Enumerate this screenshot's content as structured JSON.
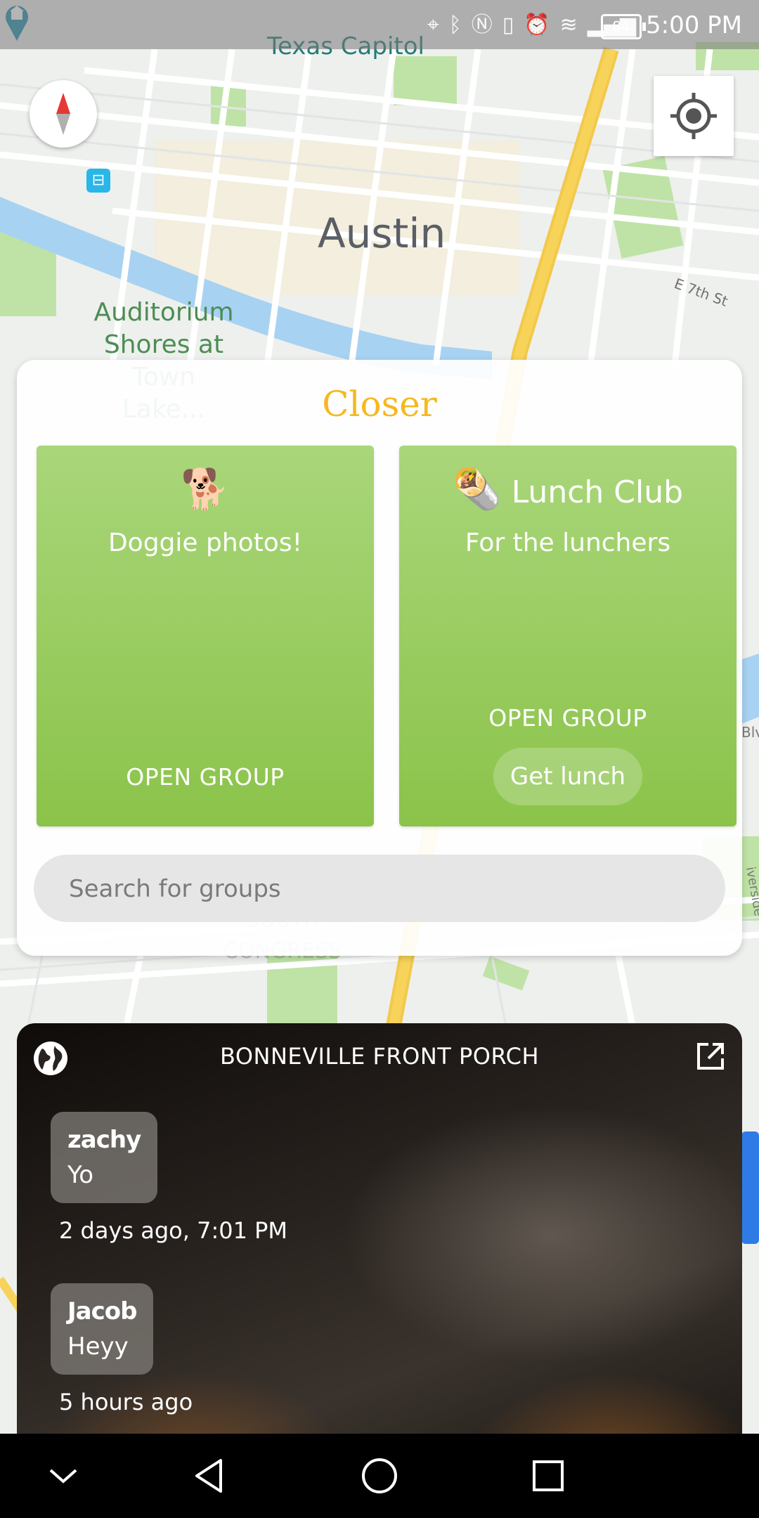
{
  "status_bar": {
    "time": "5:00 PM",
    "battery": "84",
    "icons": [
      "location-icon",
      "bluetooth-icon",
      "nfc-icon",
      "vibrate-icon",
      "alarm-icon",
      "wifi-icon",
      "signal-icon"
    ]
  },
  "map": {
    "labels": {
      "capitol": "Texas Capitol",
      "city": "Austin",
      "auditorium": "Auditorium Shores at Town Lake...",
      "e7th": "E 7th St",
      "south_congress": "SOUTH CONGRESS",
      "blv": "Blv",
      "riverside": "iverside"
    },
    "colors": {
      "water": "#a8d2f2",
      "park": "#bfe3a6",
      "highway": "#f7d35a",
      "road": "#ffffff"
    }
  },
  "closer": {
    "title": "Closer",
    "groups": [
      {
        "emoji": "🐕",
        "name": "",
        "description": "Doggie photos!",
        "open_label": "OPEN GROUP"
      },
      {
        "emoji": "🌯",
        "name": "Lunch Club",
        "description": "For the lunchers",
        "open_label": "OPEN GROUP",
        "action_label": "Get lunch"
      }
    ],
    "search_placeholder": "Search for groups",
    "colors": {
      "title": "#f5b81f",
      "card": "#8bc34a"
    }
  },
  "chat": {
    "title": "BONNEVILLE FRONT PORCH",
    "messages": [
      {
        "user": "zachy",
        "text": "Yo",
        "time": "2 days ago, 7:01 PM"
      },
      {
        "user": "Jacob",
        "text": "Heyy",
        "time": "5 hours ago"
      }
    ]
  },
  "nav": {
    "buttons": [
      "chevron-down-icon",
      "back-icon",
      "home-icon",
      "recents-icon"
    ]
  }
}
